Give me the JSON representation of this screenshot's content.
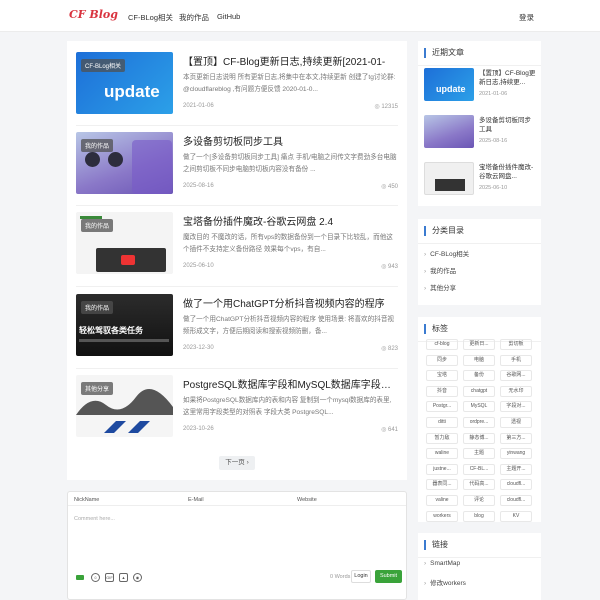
{
  "header": {
    "logo": "CF Blog",
    "nav": [
      "CF-BLog相关",
      "我的作品",
      "GitHub"
    ],
    "login": "登录"
  },
  "posts": [
    {
      "tag": "CF-BLog相关",
      "title": "【置顶】CF-Blog更新日志,持续更新[2021-01-",
      "excerpt": "本页更新日志说明 所有更新日志,将集中在本文,持续更新 创建了tg讨论群: @cloudflareblog ,有问题方便反馈 2020-01-0...",
      "date": "2021-01-06",
      "views": "12315",
      "thumb_text": "update"
    },
    {
      "tag": "我的作品",
      "title": "多设备剪切板同步工具",
      "excerpt": "做了一个[多设备剪切板同步工具] 痛点 手机/电脑之间传文字费劲多台电脑之间剪切板不同步电脑剪切板内容没有备份 ...",
      "date": "2025-08-16",
      "views": "450"
    },
    {
      "tag": "我的作品",
      "title": "宝塔备份插件魔改-谷歌云网盘 2.4",
      "excerpt": "魔改目的 不魔改的话，所有vps的数据备份到一个目录下比较乱，而他这个插件不支持定义备份路径 效果每个vps，有自...",
      "date": "2025-06-10",
      "views": "943"
    },
    {
      "tag": "我的作品",
      "title": "做了一个用ChatGPT分析抖音视频内容的程序",
      "excerpt": "做了一个用ChatGPT分析抖音视频内容的程序 使用场景: 将喜欢的抖音视频形成文字，方便后期阅读和搜索视频防删，备...",
      "date": "2023-12-30",
      "views": "823",
      "thumb_text": "轻松驾驭各类任务"
    },
    {
      "tag": "其他分享",
      "title": "PostgreSQL数据库字段和MySQL数据库字段对...",
      "excerpt": "如果将PostgreSQL数据库内的表和内容 复制到一个mysql数据库的表里,这里常用字段类型的对照表 字段大类 PostgreSQL...",
      "date": "2023-10-26",
      "views": "641"
    }
  ],
  "pagination": {
    "next": "下一页"
  },
  "comment": {
    "nick_label": "NickName",
    "email_label": "E-Mail",
    "website_label": "Website",
    "placeholder": "Comment here...",
    "words": "0  Words",
    "login": "Login",
    "submit": "Submit",
    "gif_label": "GIF"
  },
  "sidebar": {
    "recent_title": "近期文章",
    "recent": [
      {
        "title": "【置顶】CF-Blog更新日志,持续更...",
        "date": "2021-01-06"
      },
      {
        "title": "多设备剪切板同步工具",
        "date": "2025-08-16"
      },
      {
        "title": "宝塔备份插件魔改-谷歌云网盘...",
        "date": "2025-06-10"
      }
    ],
    "categories_title": "分类目录",
    "categories": [
      "CF-BLog相关",
      "我的作品",
      "其他分享"
    ],
    "tags_title": "标签",
    "tags": [
      "cf-blog",
      "更新日...",
      "剪切板",
      "同步",
      "电脑",
      "手机",
      "宝塔",
      "备份",
      "谷歌网...",
      "抖音",
      "chatgpt",
      "无水印",
      "Postgr...",
      "MySQL",
      "字段对...",
      "ditti",
      "ordpre...",
      "透视",
      "暂力敌",
      "静态博...",
      "第三方...",
      "waline",
      "主题",
      "yinwang",
      "justne...",
      "CF-BL...",
      "主题开...",
      "器表同...",
      "代码高...",
      "cloudfl...",
      "valine",
      "评论",
      "cloudfl...",
      "workers",
      "blog",
      "KV"
    ],
    "links_title": "链接",
    "links": [
      "SmartMap",
      "修改workers"
    ]
  },
  "colors": {
    "accent": "#3b7bd0",
    "brand": "#d9333f",
    "submit": "#3aa33a"
  }
}
